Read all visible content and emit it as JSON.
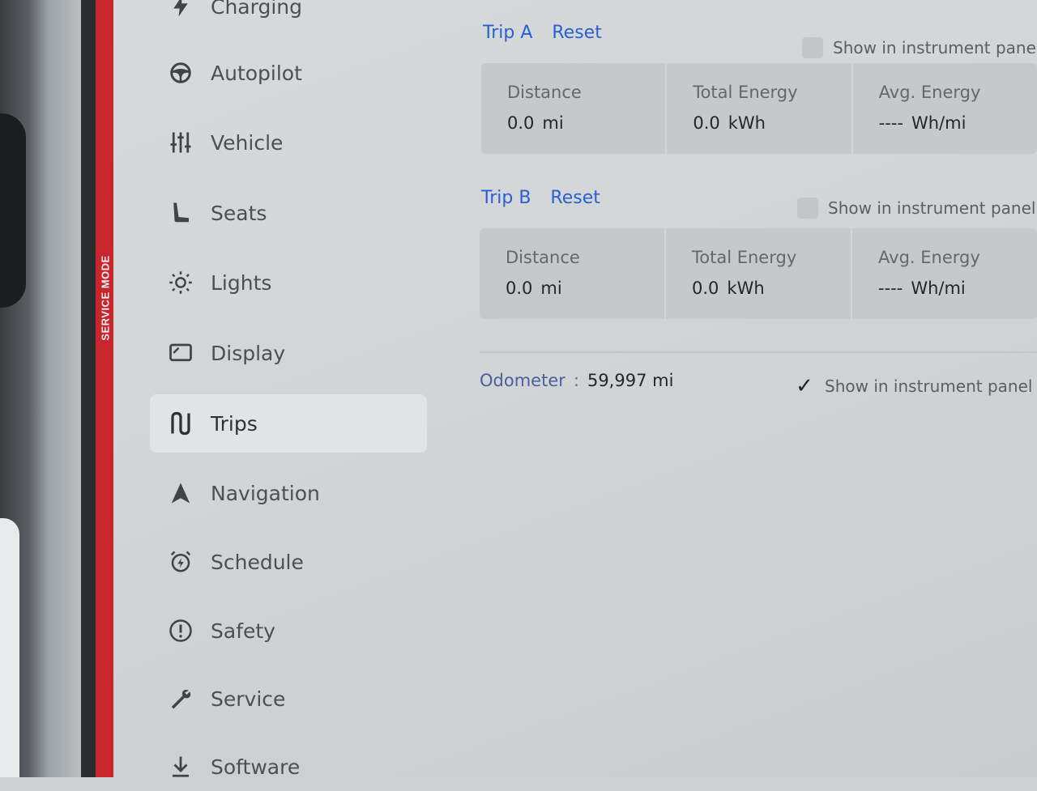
{
  "service_mode_label": "SERVICE MODE",
  "sidebar": {
    "items": [
      {
        "label": "Charging",
        "icon": "bolt-icon"
      },
      {
        "label": "Autopilot",
        "icon": "steering-wheel-icon"
      },
      {
        "label": "Vehicle",
        "icon": "sliders-icon"
      },
      {
        "label": "Seats",
        "icon": "seat-icon"
      },
      {
        "label": "Lights",
        "icon": "sun-icon"
      },
      {
        "label": "Display",
        "icon": "display-icon"
      },
      {
        "label": "Trips",
        "icon": "trips-icon",
        "active": true
      },
      {
        "label": "Navigation",
        "icon": "navigation-arrow-icon"
      },
      {
        "label": "Schedule",
        "icon": "alarm-clock-icon"
      },
      {
        "label": "Safety",
        "icon": "exclamation-circle-icon"
      },
      {
        "label": "Service",
        "icon": "wrench-icon"
      },
      {
        "label": "Software",
        "icon": "download-arrow-icon"
      }
    ]
  },
  "trip_a": {
    "title": "Trip A",
    "reset_label": "Reset",
    "show_label": "Show in instrument panel",
    "show_checked": false,
    "distance_label": "Distance",
    "distance_value": "0.0",
    "distance_unit": "mi",
    "energy_label": "Total Energy",
    "energy_value": "0.0",
    "energy_unit": "kWh",
    "avg_label": "Avg. Energy",
    "avg_value": "----",
    "avg_unit": "Wh/mi"
  },
  "trip_b": {
    "title": "Trip B",
    "reset_label": "Reset",
    "show_label": "Show in instrument panel",
    "show_checked": false,
    "distance_label": "Distance",
    "distance_value": "0.0",
    "distance_unit": "mi",
    "energy_label": "Total Energy",
    "energy_value": "0.0",
    "energy_unit": "kWh",
    "avg_label": "Avg. Energy",
    "avg_value": "----",
    "avg_unit": "Wh/mi"
  },
  "odometer": {
    "label": "Odometer",
    "separator": ":",
    "value": "59,997",
    "unit": "mi",
    "show_label": "Show in instrument panel",
    "show_checked": true
  },
  "colors": {
    "accent": "#2a5fd1",
    "service_strip": "#c8262c"
  }
}
